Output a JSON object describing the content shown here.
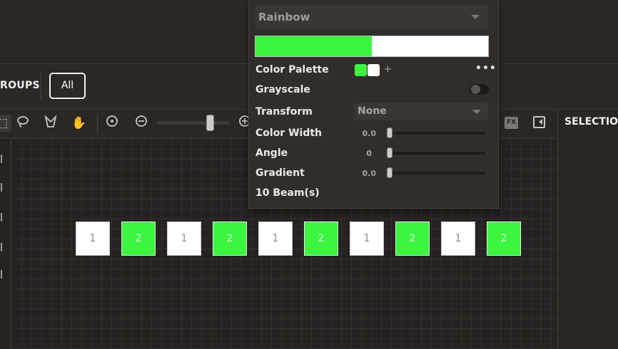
{
  "groups": {
    "label": "ROUPS",
    "all_button": "All"
  },
  "toolbar": {
    "tools": [
      "select-icon",
      "lasso-icon",
      "magic-select-icon",
      "hand-pan-icon",
      "zoom-fit-icon",
      "zoom-out-icon",
      "zoom-in-icon"
    ],
    "zoom_level": 0.72,
    "fx_label": "FX",
    "selection_label": "SELECTION"
  },
  "popup": {
    "preset": "Rainbow",
    "gradient_colors": [
      "#3bf53f",
      "#ffffff"
    ],
    "color_palette_label": "Color Palette",
    "palette_swatches": [
      "#3bf53f",
      "#ffffff"
    ],
    "add_label": "+",
    "more_label": "•••",
    "grayscale_label": "Grayscale",
    "grayscale_on": false,
    "transform_label": "Transform",
    "transform_value": "None",
    "color_width_label": "Color Width",
    "color_width_value": "0.0",
    "angle_label": "Angle",
    "angle_value": "0",
    "gradient_label": "Gradient",
    "gradient_value": "0.0",
    "beam_count": "10 Beam(s)"
  },
  "beams": [
    {
      "label": "1",
      "color": "white"
    },
    {
      "label": "2",
      "color": "green"
    },
    {
      "label": "1",
      "color": "white"
    },
    {
      "label": "2",
      "color": "green"
    },
    {
      "label": "1",
      "color": "white"
    },
    {
      "label": "2",
      "color": "green"
    },
    {
      "label": "1",
      "color": "white"
    },
    {
      "label": "2",
      "color": "green"
    },
    {
      "label": "1",
      "color": "white"
    },
    {
      "label": "2",
      "color": "green"
    }
  ]
}
